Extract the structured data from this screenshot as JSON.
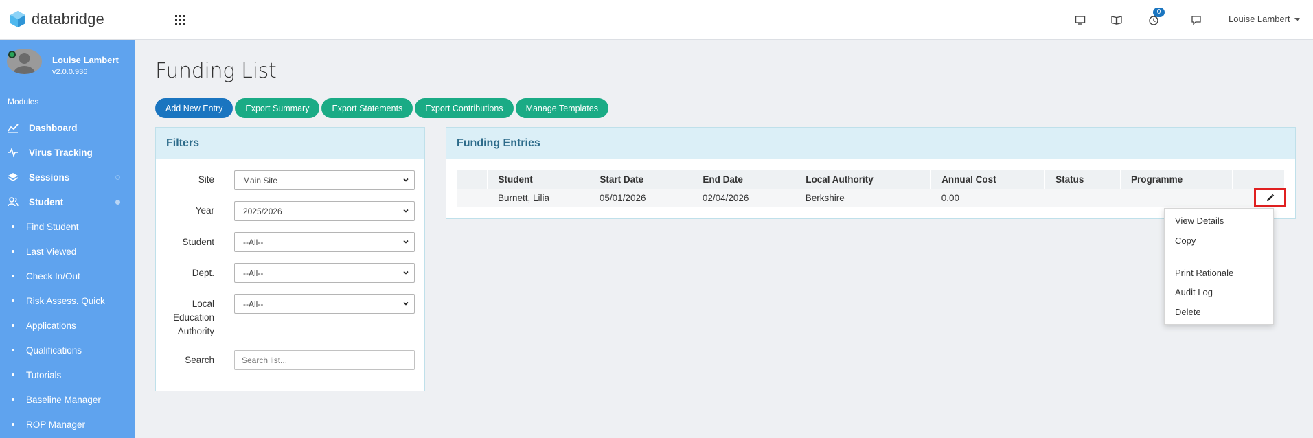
{
  "header": {
    "brand": "databridge",
    "notification_count": "0",
    "user_name": "Louise Lambert"
  },
  "icons": {
    "apps": "grid-icon",
    "screen": "monitor-icon",
    "book": "book-icon",
    "timer": "clock-icon",
    "chat": "chat-icon"
  },
  "sidebar": {
    "profile_name": "Louise Lambert",
    "version": "v2.0.0.936",
    "modules_label": "Modules",
    "items": [
      {
        "label": "Dashboard"
      },
      {
        "label": "Virus Tracking"
      },
      {
        "label": "Sessions"
      },
      {
        "label": "Student"
      },
      {
        "label": "Find Student"
      },
      {
        "label": "Last Viewed"
      },
      {
        "label": "Check In/Out"
      },
      {
        "label": "Risk Assess. Quick"
      },
      {
        "label": "Applications"
      },
      {
        "label": "Qualifications"
      },
      {
        "label": "Tutorials"
      },
      {
        "label": "Baseline Manager"
      },
      {
        "label": "ROP Manager"
      }
    ]
  },
  "page": {
    "title": "Funding List",
    "buttons": {
      "add": "Add New Entry",
      "export_summary": "Export Summary",
      "export_statements": "Export Statements",
      "export_contributions": "Export Contributions",
      "manage_templates": "Manage Templates"
    }
  },
  "filters": {
    "title": "Filters",
    "site_label": "Site",
    "site_value": "Main Site",
    "year_label": "Year",
    "year_value": "2025/2026",
    "student_label": "Student",
    "student_value": "--All--",
    "dept_label": "Dept.",
    "dept_value": "--All--",
    "lea_label_1": "Local",
    "lea_label_2": "Education",
    "lea_label_3": "Authority",
    "lea_value": "--All--",
    "search_label": "Search",
    "search_placeholder": "Search list..."
  },
  "entries": {
    "title": "Funding Entries",
    "columns": [
      "Student",
      "Start Date",
      "End Date",
      "Local Authority",
      "Annual Cost",
      "Status",
      "Programme"
    ],
    "rows": [
      {
        "student": "Burnett, Lilia",
        "start_date": "05/01/2026",
        "end_date": "02/04/2026",
        "local_authority": "Berkshire",
        "annual_cost": "0.00",
        "status": "",
        "programme": ""
      }
    ]
  },
  "context_menu": {
    "items": [
      "View Details",
      "Copy",
      "Print Rationale",
      "Audit Log",
      "Delete"
    ]
  },
  "colors": {
    "sidebar": "#5fa3ee",
    "primary": "#1a75c0",
    "success": "#1aab85",
    "highlight": "#e02020"
  }
}
